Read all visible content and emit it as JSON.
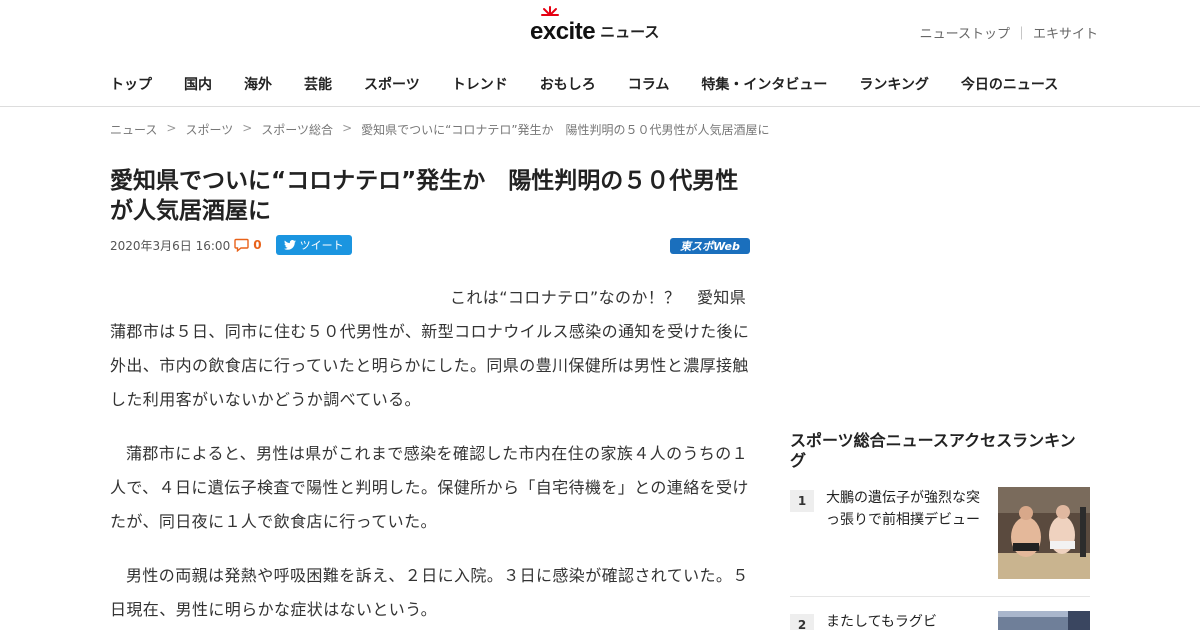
{
  "header": {
    "logo_text": "excite",
    "logo_suffix": "ニュース",
    "top_links": [
      "ニューストップ",
      "エキサイト"
    ],
    "top_links_sep": "｜"
  },
  "nav": [
    "トップ",
    "国内",
    "海外",
    "芸能",
    "スポーツ",
    "トレンド",
    "おもしろ",
    "コラム",
    "特集・インタビュー",
    "ランキング",
    "今日のニュース"
  ],
  "breadcrumb": {
    "sep": ">",
    "items": [
      "ニュース",
      "スポーツ",
      "スポーツ総合",
      "愛知県でついに“コロナテロ”発生か　陽性判明の５０代男性が人気居酒屋に"
    ]
  },
  "article": {
    "title": "愛知県でついに“コロナテロ”発生か　陽性判明の５０代男性が人気居酒屋に",
    "date": "2020年3月6日 16:00",
    "comment_count": "0",
    "tweet_label": "ツイート",
    "source": "東スポWeb",
    "paragraphs": [
      "これは“コロナテロ”なのか！？　愛知県蒲郡市は５日、同市に住む５０代男性が、新型コロナウイルス感染の通知を受けた後に外出、市内の飲食店に行っていたと明らかにした。同県の豊川保健所は男性と濃厚接触した利用客がいないかどうか調べている。",
      "蒲郡市によると、男性は県がこれまで感染を確認した市内在住の家族４人のうちの１人で、４日に遺伝子検査で陽性と判明した。保健所から「自宅待機を」との連絡を受けたが、同日夜に１人で飲食店に行っていた。",
      "男性の両親は発熱や呼吸困難を訴え、２日に入院。３日に感染が確認されていた。５日現在、男性に明らかな症状はないという。"
    ]
  },
  "sidebar": {
    "ranking_title": "スポーツ総合ニュースアクセスランキング",
    "items": [
      {
        "rank": "1",
        "title": "大鵬の遺伝子が強烈な突っ張りで前相撲デビュー"
      },
      {
        "rank": "2",
        "title": "またしてもラグビ"
      }
    ]
  },
  "colors": {
    "accent_orange": "#e8621a",
    "twitter_blue": "#1b95e0",
    "source_blue": "#1a6fbd"
  }
}
